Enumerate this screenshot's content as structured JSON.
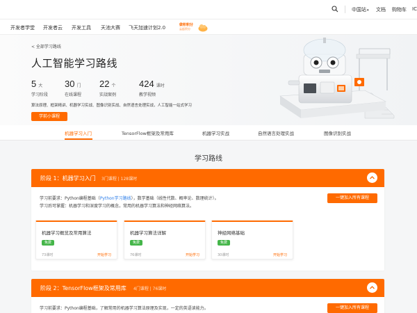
{
  "topbar": {
    "region": "中国站",
    "docs": "文档",
    "cart": "购物车",
    "more": "IC"
  },
  "nav": {
    "items": [
      "开发者学堂",
      "开发者云",
      "开发工具",
      "天池大赛",
      "飞天加速计划2.0"
    ],
    "promo_line1": "做积积分",
    "promo_line2": "云起积分"
  },
  "hero": {
    "back": "< 全部学习路线",
    "title": "人工智能学习路线",
    "stats": [
      {
        "num": "5",
        "unit": "大",
        "label": "学习阶段"
      },
      {
        "num": "30",
        "unit": "门",
        "label": "在线课程"
      },
      {
        "num": "22",
        "unit": "个",
        "label": "实战案例"
      },
      {
        "num": "424",
        "unit": "课时",
        "label": "教学视频"
      }
    ],
    "desc": "算法原理、框架精讲、机器学习实战、图像识别实战、自然语言处理实战，人工智能一站式学习",
    "video_button": "学前小课程"
  },
  "tabs": [
    "机器学习入门",
    "TensorFlow框架及常用库",
    "机器学习实战",
    "自然语言处理实战",
    "图像识别实战"
  ],
  "section_title": "学习路线",
  "stages": [
    {
      "title": "阶段 1：机器学习入门",
      "meta": "3门课程 | 128课时",
      "req_prefix": "学习前要求：Python编程基础（",
      "req_link": "Python学习路线",
      "req_suffix": "），数学基础（线性代数、概率论、数理统计）。",
      "goal": "学习后可掌握：机器学习和深度学习的概念，常用的机器学习算法和神经网络算法。",
      "join_button": "一键加入所有课程",
      "courses": [
        {
          "title": "机器学习概览及常用算法",
          "badge": "免费",
          "hours": "73课时",
          "start": "开始学习"
        },
        {
          "title": "机器学习算法详解",
          "badge": "免费",
          "hours": "76课时",
          "start": "开始学习"
        },
        {
          "title": "神经网络基础",
          "badge": "免费",
          "hours": "30课时",
          "start": "开始学习"
        }
      ]
    },
    {
      "title": "阶段 2：TensorFlow框架及常用库",
      "meta": "4门课程 | 76课时",
      "req_prefix": "学习前要求：Python编程基础，了解常用的机器学习算法原理及实现，一定的英语读能力。",
      "req_link": "",
      "req_suffix": "",
      "goal": "",
      "join_button": "一键加入所有课程",
      "courses": []
    }
  ]
}
